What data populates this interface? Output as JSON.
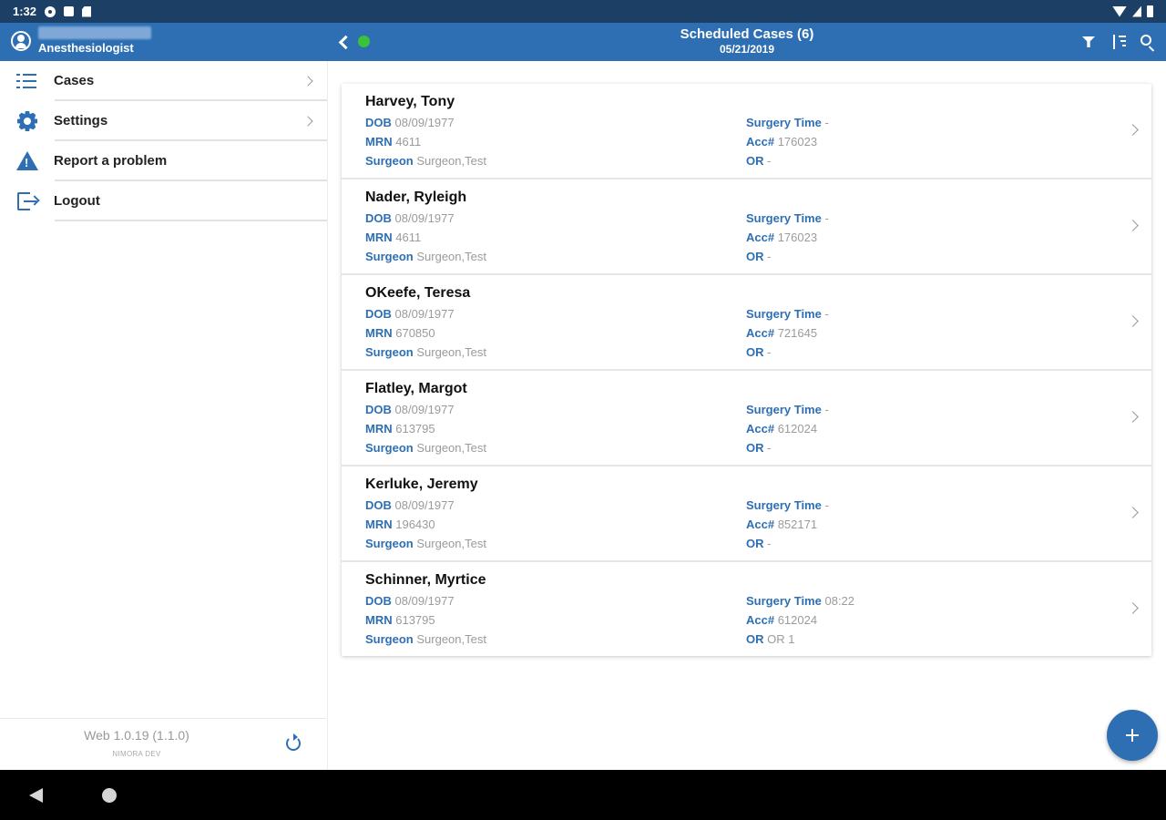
{
  "status_bar": {
    "time": "1:32"
  },
  "header": {
    "user_role": "Anesthesiologist",
    "title": "Scheduled Cases (6)",
    "date": "05/21/2019"
  },
  "sidebar": {
    "items": [
      {
        "label": "Cases"
      },
      {
        "label": "Settings"
      },
      {
        "label": "Report a problem"
      },
      {
        "label": "Logout"
      }
    ],
    "version": "Web 1.0.19 (1.1.0)",
    "environment": "NIMORA DEV"
  },
  "labels": {
    "dob": "DOB",
    "mrn": "MRN",
    "surgeon": "Surgeon",
    "surgery_time": "Surgery Time",
    "acc": "Acc#",
    "or": "OR"
  },
  "cases": [
    {
      "name": "Harvey, Tony",
      "dob": "08/09/1977",
      "mrn": "4611",
      "surgeon": "Surgeon,Test",
      "surgery_time": "-",
      "acc": "176023",
      "or": "-"
    },
    {
      "name": "Nader, Ryleigh",
      "dob": "08/09/1977",
      "mrn": "4611",
      "surgeon": "Surgeon,Test",
      "surgery_time": "-",
      "acc": "176023",
      "or": "-"
    },
    {
      "name": "OKeefe, Teresa",
      "dob": "08/09/1977",
      "mrn": "670850",
      "surgeon": "Surgeon,Test",
      "surgery_time": "-",
      "acc": "721645",
      "or": "-"
    },
    {
      "name": "Flatley, Margot",
      "dob": "08/09/1977",
      "mrn": "613795",
      "surgeon": "Surgeon,Test",
      "surgery_time": "-",
      "acc": "612024",
      "or": "-"
    },
    {
      "name": "Kerluke, Jeremy",
      "dob": "08/09/1977",
      "mrn": "196430",
      "surgeon": "Surgeon,Test",
      "surgery_time": "-",
      "acc": "852171",
      "or": "-"
    },
    {
      "name": "Schinner, Myrtice",
      "dob": "08/09/1977",
      "mrn": "613795",
      "surgeon": "Surgeon,Test",
      "surgery_time": "08:22",
      "acc": "612024",
      "or": "OR 1"
    }
  ],
  "colors": {
    "primary": "#2e6fb3",
    "status_bar": "#1c3f66",
    "online": "#3cc13b"
  }
}
